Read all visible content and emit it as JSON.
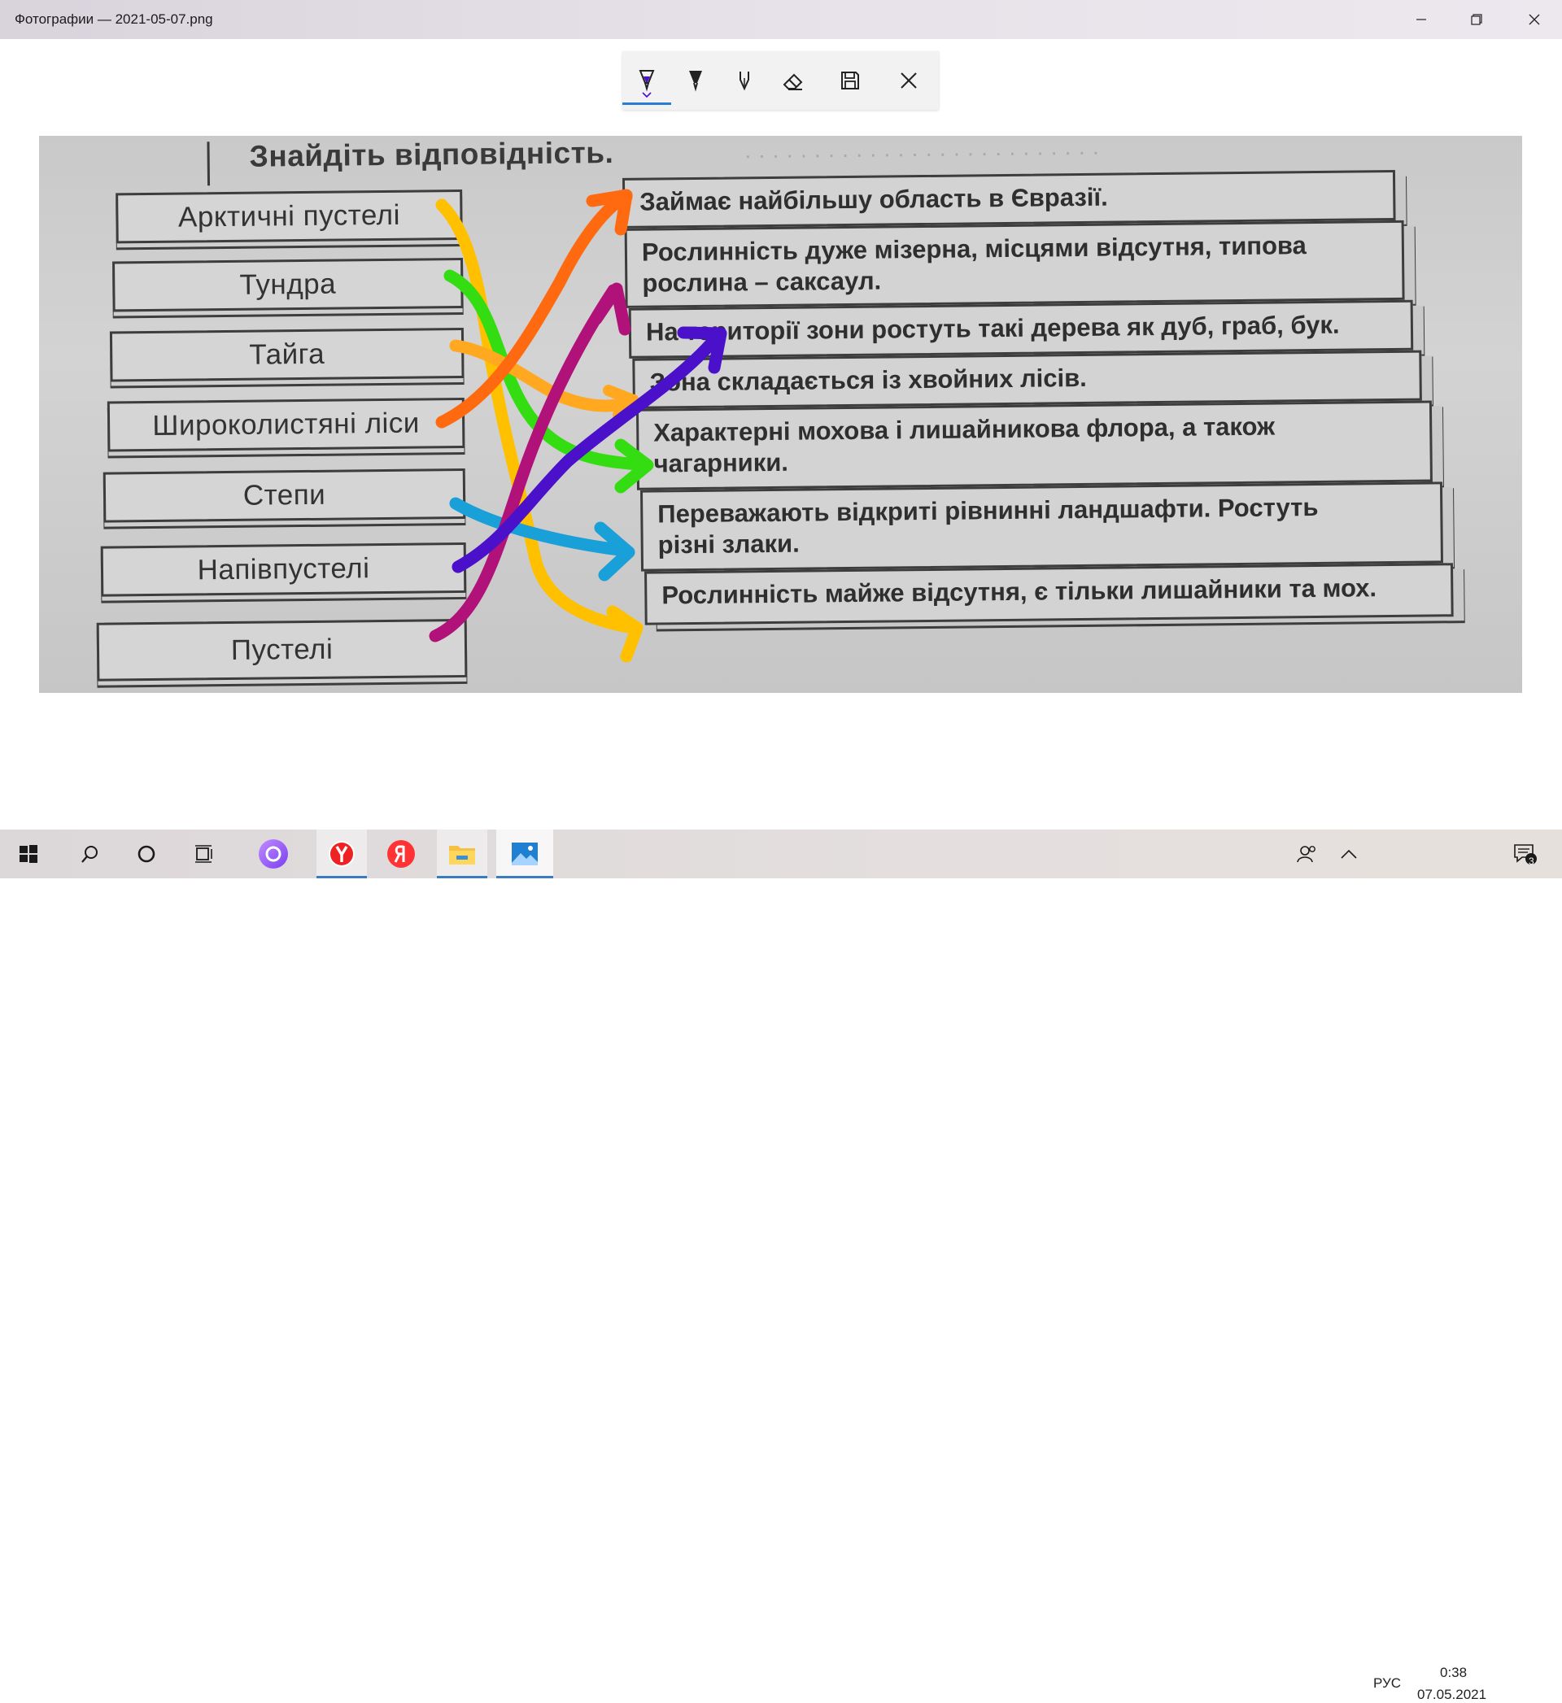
{
  "window": {
    "title": "Фотографии — 2021-05-07.png",
    "minimize_icon": "minimize-icon",
    "maximize_icon": "restore-icon",
    "close_icon": "close-icon"
  },
  "ink_toolbar": {
    "tools": [
      "ballpoint-pen-icon",
      "pencil-icon",
      "calligraphy-pen-icon",
      "eraser-icon",
      "save-icon",
      "close-icon"
    ],
    "active_tool": "ballpoint-pen-icon",
    "active_color": "#4b10c9"
  },
  "photo": {
    "heading": "Знайдіть відповідність.",
    "left_items": [
      "Арктичні пустелі",
      "Тундра",
      "Тайга",
      "Широколистяні ліси",
      "Степи",
      "Напівпустелі",
      "Пустелі"
    ],
    "right_items": [
      [
        "Займає найбільшу область в Євразії."
      ],
      [
        "Рослинність дуже мізерна, місцями відсутня, типова",
        "рослина – саксаул."
      ],
      [
        "На території зони ростуть такі дерева як дуб, граб, бук."
      ],
      [
        "Зона складається із хвойних лісів."
      ],
      [
        "Характерні мохова і лишайникова флора, а також",
        "чагарники."
      ],
      [
        "Переважають відкриті рівнинні ландшафти. Ростуть",
        "різні злаки."
      ],
      [
        "Рослинність майже відсутня, є тільки лишайники та мох."
      ]
    ],
    "ink_colors": {
      "yellow": "#ffc000",
      "green": "#33dd11",
      "orange": "#ff6a10",
      "light_orange": "#ffa820",
      "cyan": "#1aa0d8",
      "magenta": "#b0127a",
      "purple": "#4b10c9"
    }
  },
  "taskbar": {
    "items": [
      "windows-start-icon",
      "search-icon",
      "cortana-icon",
      "task-view-icon",
      "alice-icon",
      "yandex-browser-icon",
      "yandex-icon",
      "file-explorer-icon",
      "photos-icon"
    ],
    "tray": {
      "people_icon": "people-icon",
      "chevron_icon": "chevron-up-icon",
      "language": "РУС",
      "time": "0:38",
      "date": "07.05.2021",
      "notifications_count": "3"
    }
  }
}
